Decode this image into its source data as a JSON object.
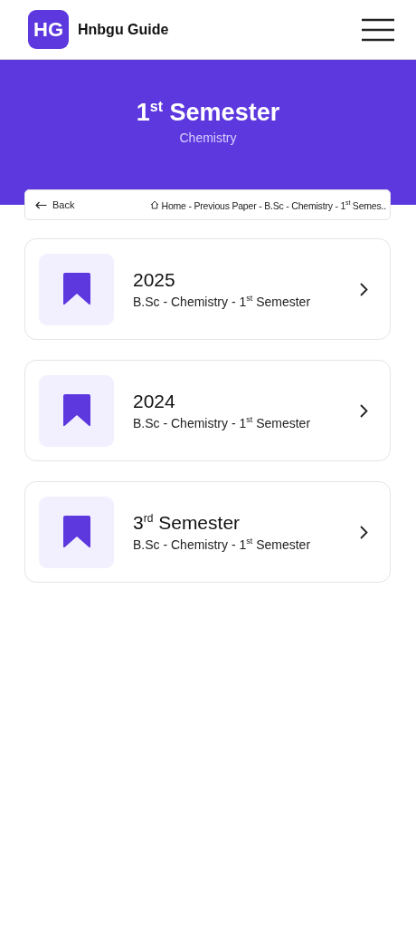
{
  "header": {
    "logo": "HG",
    "site_name": "Hnbgu Guide"
  },
  "hero": {
    "title": "1$^{st}$ Semester",
    "subtitle": "Chemistry"
  },
  "breadcrumb": {
    "back": "Back",
    "trail": "Home - Previous Paper - B.Sc - Chemistry - 1$^{st}$ Semes.."
  },
  "items": [
    {
      "title": "2025",
      "subtitle": "B.Sc - Chemistry - 1$^{st}$ Semester"
    },
    {
      "title": "2024",
      "subtitle": "B.Sc - Chemistry - 1$^{st}$ Semester"
    },
    {
      "title": "3$^{rd}$ Semester",
      "subtitle": "B.Sc - Chemistry - 1$^{st}$ Semester"
    }
  ]
}
